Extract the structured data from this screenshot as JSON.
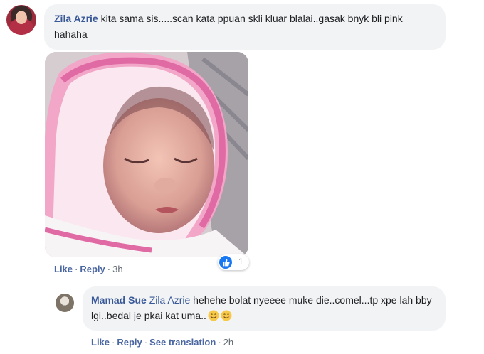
{
  "comment": {
    "author": "Zila Azrie",
    "text": "kita sama sis.....scan kata ppuan skli kluar blalai..gasak bnyk bli pink hahaha",
    "actions": {
      "like": "Like",
      "reply": "Reply",
      "time": "3h"
    },
    "reaction": {
      "icon": "thumbs-up-icon",
      "count": "1",
      "color": "#1877f2"
    }
  },
  "reply": {
    "author": "Mamad Sue",
    "mention": "Zila Azrie",
    "text": "hehehe bolat nyeeee muke die..comel...tp xpe lah bby lgi..bedal je pkai kat uma..",
    "emojis": [
      "smiling-face-icon",
      "smiling-face-icon"
    ],
    "actions": {
      "like": "Like",
      "reply": "Reply",
      "translation": "See translation",
      "time": "2h"
    }
  },
  "colors": {
    "link": "#385898",
    "bubble": "#f2f3f5",
    "meta": "#606770"
  }
}
